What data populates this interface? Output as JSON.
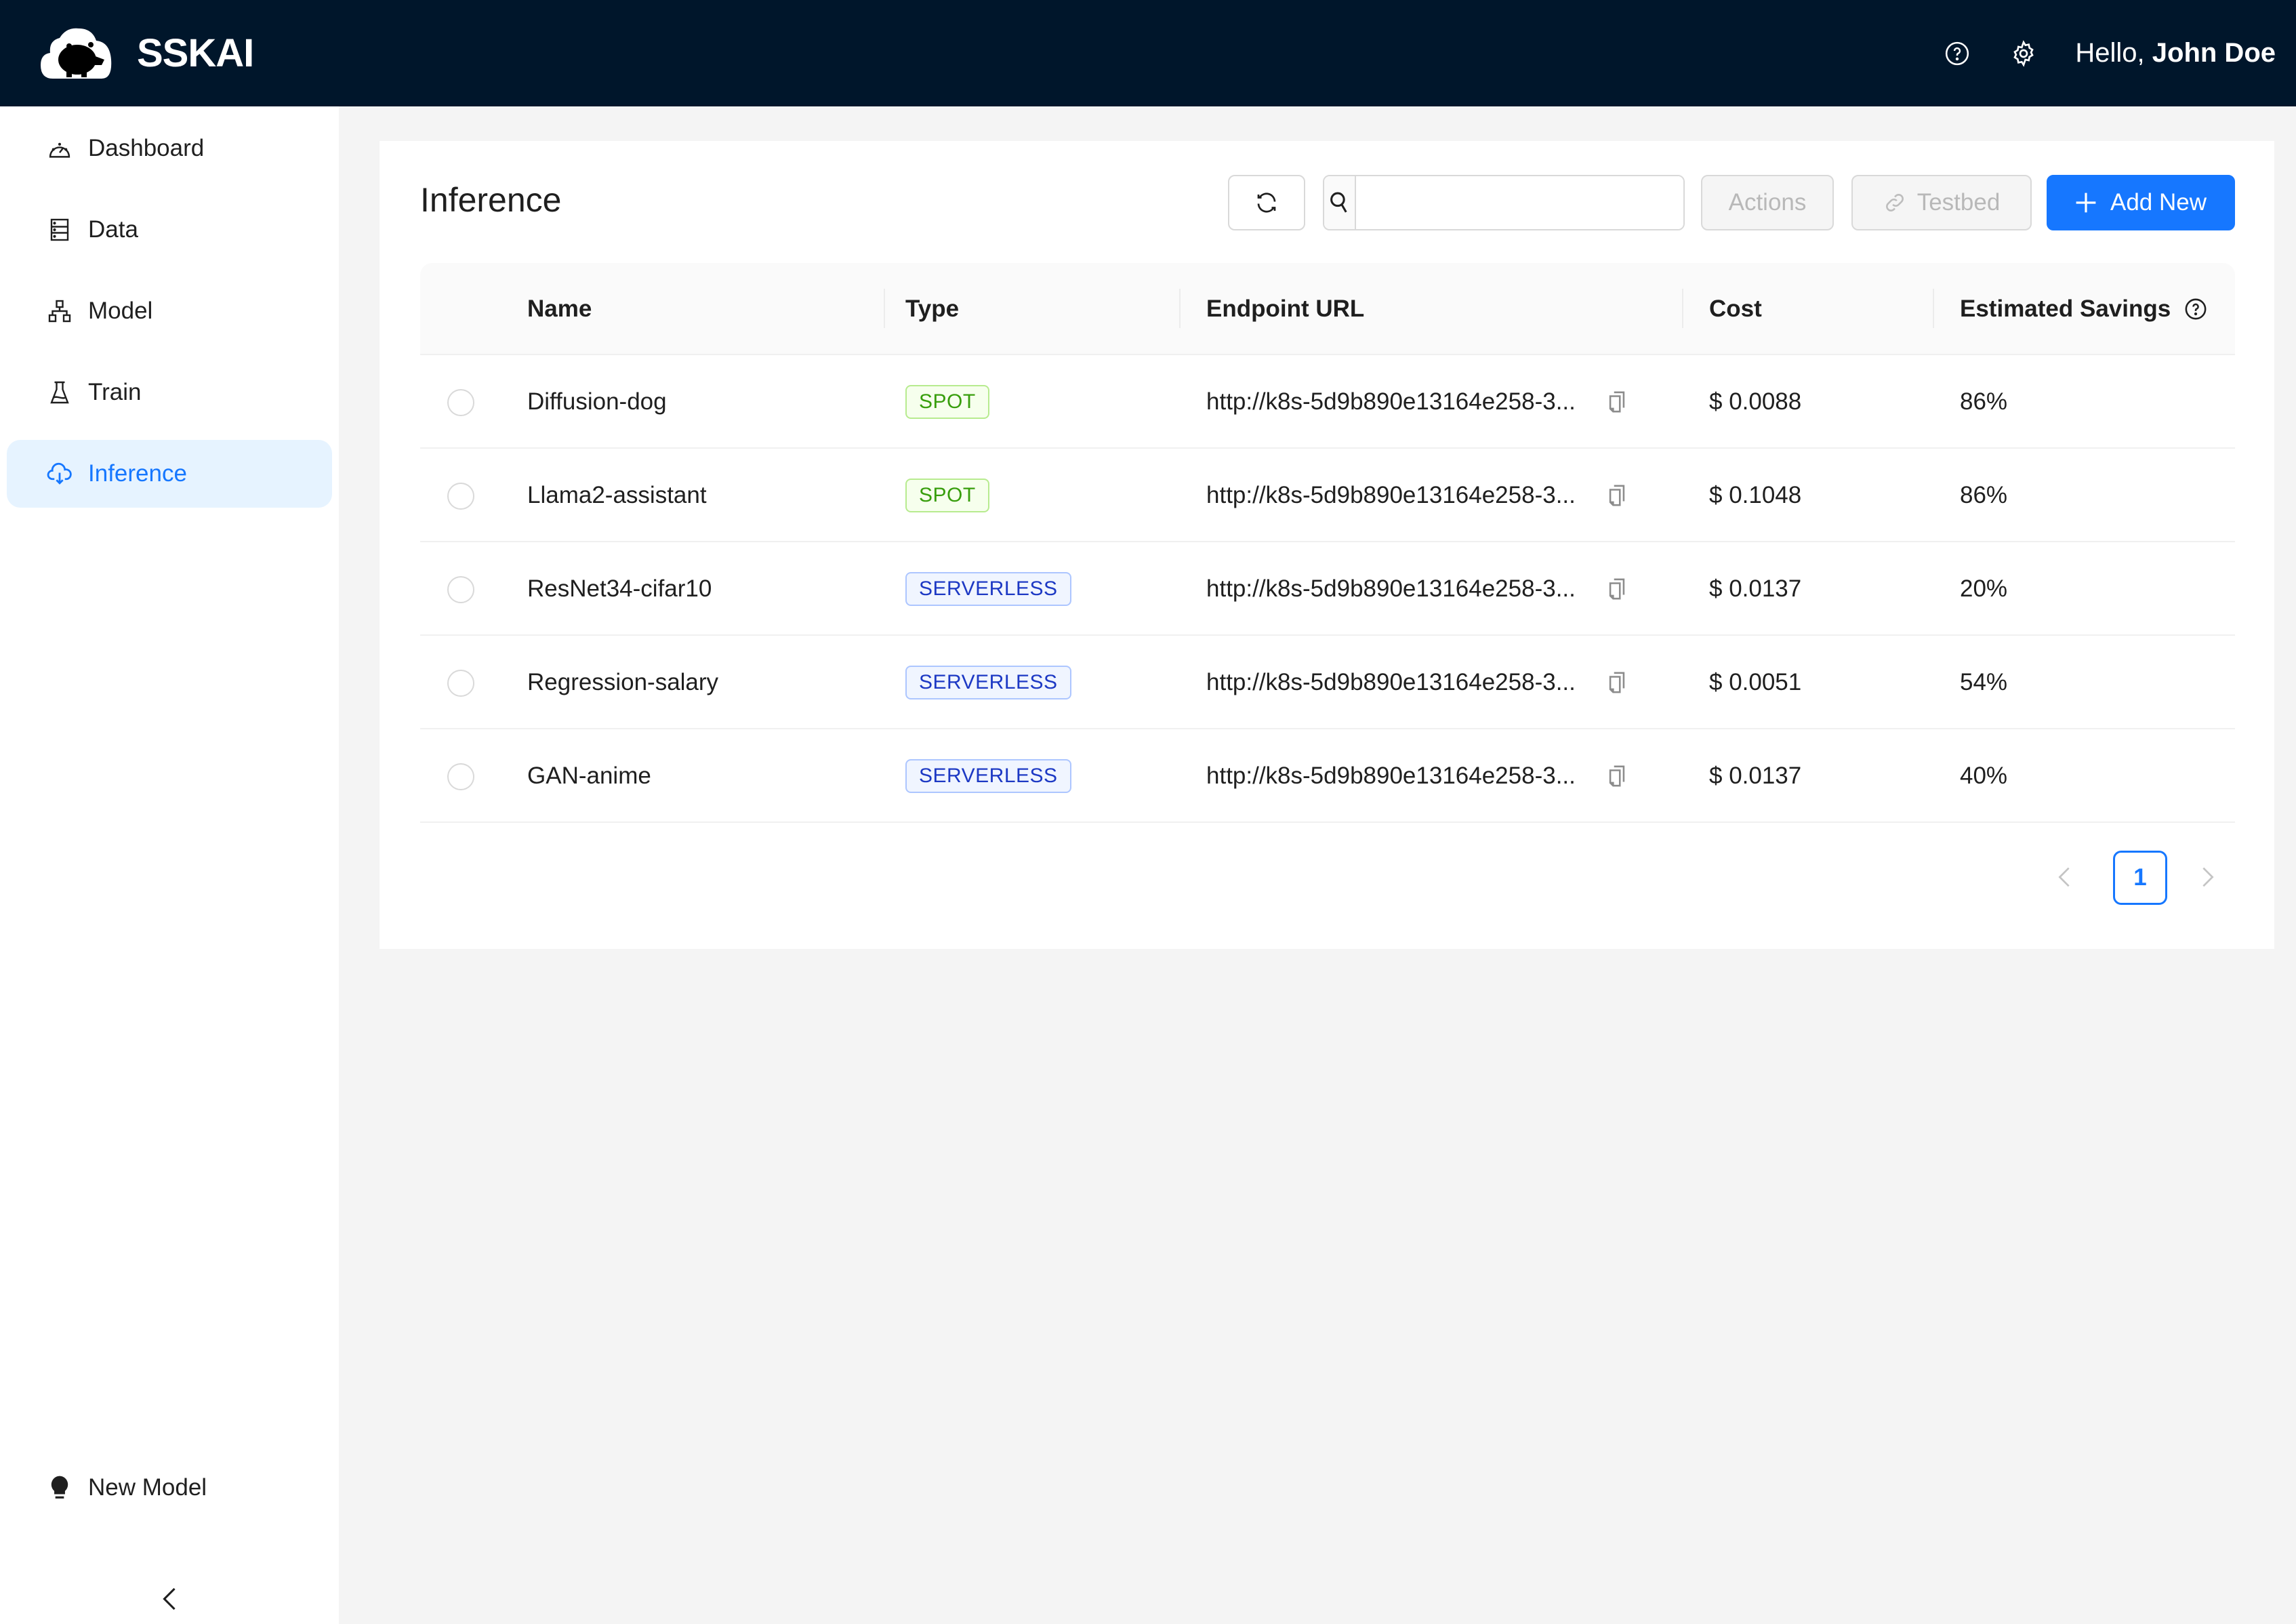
{
  "app": {
    "brand": "SSKAI"
  },
  "header": {
    "greeting": "Hello,",
    "user_name": "John Doe",
    "help_icon": "question-circle-icon",
    "settings_icon": "gear-icon"
  },
  "sidebar": {
    "items": [
      {
        "label": "Dashboard",
        "icon": "dashboard-gauge-icon",
        "active": false
      },
      {
        "label": "Data",
        "icon": "database-icon",
        "active": false
      },
      {
        "label": "Model",
        "icon": "hierarchy-icon",
        "active": false
      },
      {
        "label": "Train",
        "icon": "flask-icon",
        "active": false
      },
      {
        "label": "Inference",
        "icon": "cloud-download-icon",
        "active": true
      }
    ],
    "bottom_item": {
      "label": "New Model",
      "icon": "bulb-icon"
    },
    "collapse_icon": "chevron-left-icon"
  },
  "page": {
    "title": "Inference",
    "toolbar": {
      "search_value": "",
      "search_placeholder": "",
      "actions_label": "Actions",
      "testbed_label": "Testbed",
      "add_new_label": "Add New"
    }
  },
  "table": {
    "columns": [
      "Name",
      "Type",
      "Endpoint URL",
      "Cost",
      "Estimated Savings"
    ],
    "rows": [
      {
        "name": "Diffusion-dog",
        "type": "SPOT",
        "endpoint": "http://k8s-5d9b890e13164e258-3...",
        "cost": "$ 0.0088",
        "savings": "86%"
      },
      {
        "name": "Llama2-assistant",
        "type": "SPOT",
        "endpoint": "http://k8s-5d9b890e13164e258-3...",
        "cost": "$ 0.1048",
        "savings": "86%"
      },
      {
        "name": "ResNet34-cifar10",
        "type": "SERVERLESS",
        "endpoint": "http://k8s-5d9b890e13164e258-3...",
        "cost": "$ 0.0137",
        "savings": "20%"
      },
      {
        "name": "Regression-salary",
        "type": "SERVERLESS",
        "endpoint": "http://k8s-5d9b890e13164e258-3...",
        "cost": "$ 0.0051",
        "savings": "54%"
      },
      {
        "name": "GAN-anime",
        "type": "SERVERLESS",
        "endpoint": "http://k8s-5d9b890e13164e258-3...",
        "cost": "$ 0.0137",
        "savings": "40%"
      }
    ]
  },
  "pagination": {
    "current_page": "1"
  },
  "colors": {
    "header_bg": "#00162b",
    "primary": "#1677ff",
    "active_nav_bg": "#e6f3ff",
    "spot": "#389e0d",
    "serverless": "#1d39c4"
  }
}
